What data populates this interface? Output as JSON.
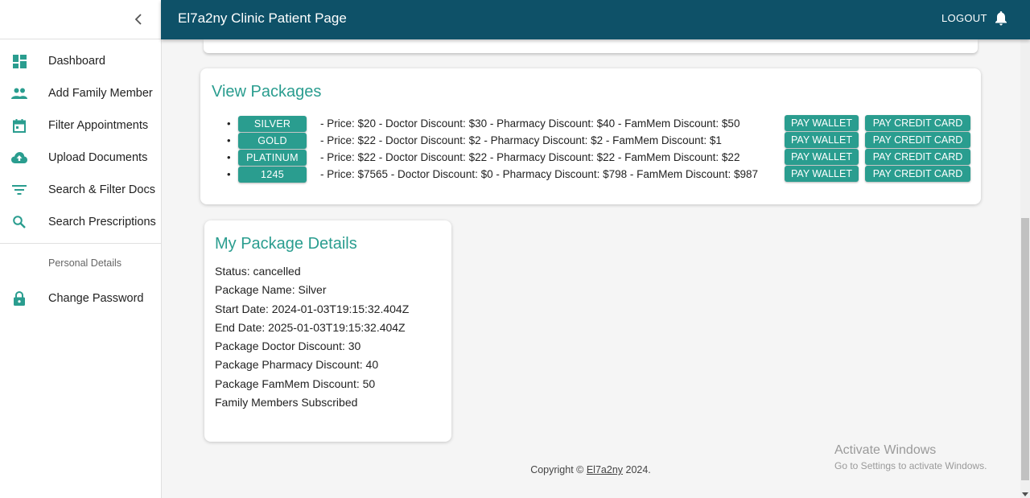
{
  "app": {
    "title": "El7a2ny Clinic Patient Page",
    "logout_label": "LOGOUT"
  },
  "sidebar": {
    "items": [
      {
        "label": "Dashboard",
        "icon": "dashboard-icon"
      },
      {
        "label": "Add Family Member",
        "icon": "people-icon"
      },
      {
        "label": "Filter Appointments",
        "icon": "calendar-icon"
      },
      {
        "label": "Upload Documents",
        "icon": "cloud-upload-icon"
      },
      {
        "label": "Search & Filter Docs",
        "icon": "filter-icon"
      },
      {
        "label": "Search Prescriptions",
        "icon": "search-icon"
      }
    ],
    "subheader": "Personal Details",
    "secondary_items": [
      {
        "label": "Change Password",
        "icon": "lock-icon"
      }
    ]
  },
  "packages": {
    "title": "View Packages",
    "wallet_label": "PAY WALLET",
    "card_label": "PAY CREDIT CARD",
    "items": [
      {
        "name": "SILVER",
        "description": "- Price: $20 - Doctor Discount: $30 - Pharmacy Discount: $40 - FamMem Discount: $50"
      },
      {
        "name": "GOLD",
        "description": "- Price: $22 - Doctor Discount: $2 - Pharmacy Discount: $2 - FamMem Discount: $1"
      },
      {
        "name": "PLATINUM",
        "description": "- Price: $22 - Doctor Discount: $22 - Pharmacy Discount: $22 - FamMem Discount: $22"
      },
      {
        "name": "1245",
        "description": "- Price: $7565 - Doctor Discount: $0 - Pharmacy Discount: $798 - FamMem Discount: $987"
      }
    ]
  },
  "details": {
    "title": "My Package Details",
    "lines": [
      "Status: cancelled",
      "Package Name: Silver",
      "Start Date: 2024-01-03T19:15:32.404Z",
      "End Date: 2025-01-03T19:15:32.404Z",
      "Package Doctor Discount: 30",
      "Package Pharmacy Discount: 40",
      "Package FamMem Discount: 50",
      "Family Members Subscribed"
    ]
  },
  "footer": {
    "prefix": "Copyright © ",
    "link": "El7a2ny",
    "suffix": " 2024."
  },
  "watermark": {
    "line1": "Activate Windows",
    "line2": "Go to Settings to activate Windows."
  },
  "colors": {
    "header": "#0e5168",
    "accent": "#2a9d8f"
  }
}
